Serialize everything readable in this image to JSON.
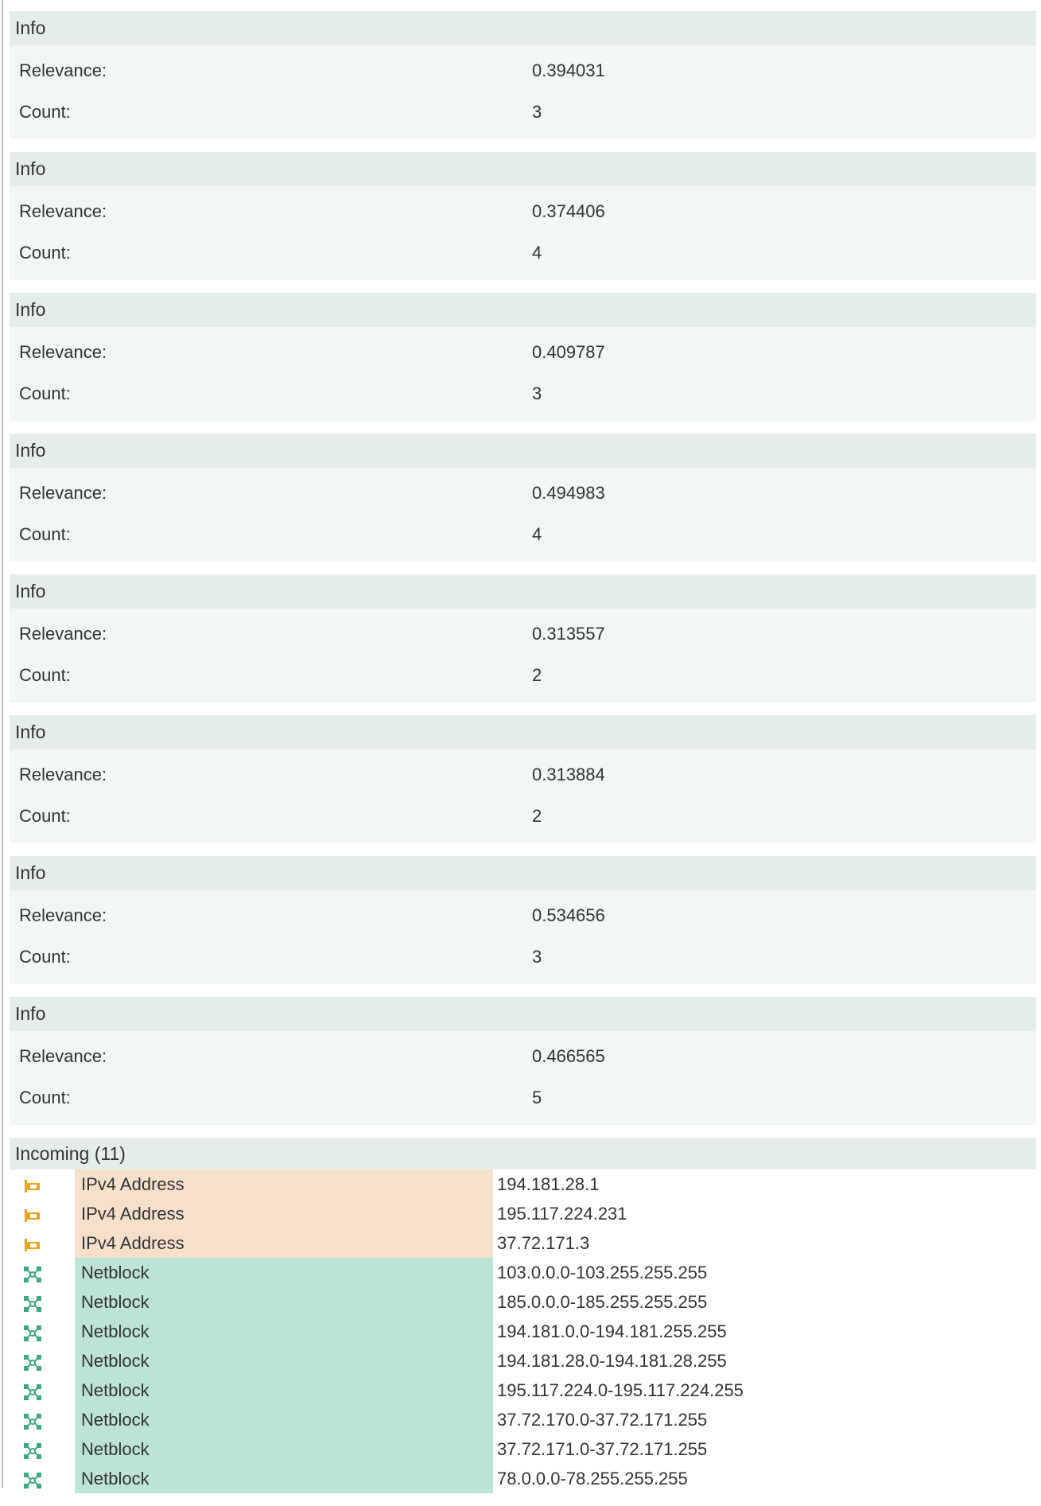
{
  "info_sections": [
    {
      "header": "Info",
      "relevance_label": "Relevance:",
      "relevance": "0.394031",
      "count_label": "Count:",
      "count": "3"
    },
    {
      "header": "Info",
      "relevance_label": "Relevance:",
      "relevance": "0.374406",
      "count_label": "Count:",
      "count": "4"
    },
    {
      "header": "Info",
      "relevance_label": "Relevance:",
      "relevance": "0.409787",
      "count_label": "Count:",
      "count": "3"
    },
    {
      "header": "Info",
      "relevance_label": "Relevance:",
      "relevance": "0.494983",
      "count_label": "Count:",
      "count": "4"
    },
    {
      "header": "Info",
      "relevance_label": "Relevance:",
      "relevance": "0.313557",
      "count_label": "Count:",
      "count": "2"
    },
    {
      "header": "Info",
      "relevance_label": "Relevance:",
      "relevance": "0.313884",
      "count_label": "Count:",
      "count": "2"
    },
    {
      "header": "Info",
      "relevance_label": "Relevance:",
      "relevance": "0.534656",
      "count_label": "Count:",
      "count": "3"
    },
    {
      "header": "Info",
      "relevance_label": "Relevance:",
      "relevance": "0.466565",
      "count_label": "Count:",
      "count": "5"
    }
  ],
  "incoming": {
    "header": "Incoming (11)",
    "rows": [
      {
        "icon": "ipv4-address-icon",
        "type": "IPv4 Address",
        "value": "194.181.28.1"
      },
      {
        "icon": "ipv4-address-icon",
        "type": "IPv4 Address",
        "value": "195.117.224.231"
      },
      {
        "icon": "ipv4-address-icon",
        "type": "IPv4 Address",
        "value": "37.72.171.3"
      },
      {
        "icon": "netblock-icon",
        "type": "Netblock",
        "value": "103.0.0.0-103.255.255.255"
      },
      {
        "icon": "netblock-icon",
        "type": "Netblock",
        "value": "185.0.0.0-185.255.255.255"
      },
      {
        "icon": "netblock-icon",
        "type": "Netblock",
        "value": "194.181.0.0-194.181.255.255"
      },
      {
        "icon": "netblock-icon",
        "type": "Netblock",
        "value": "194.181.28.0-194.181.28.255"
      },
      {
        "icon": "netblock-icon",
        "type": "Netblock",
        "value": "195.117.224.0-195.117.224.255"
      },
      {
        "icon": "netblock-icon",
        "type": "Netblock",
        "value": "37.72.170.0-37.72.171.255"
      },
      {
        "icon": "netblock-icon",
        "type": "Netblock",
        "value": "37.72.171.0-37.72.171.255"
      },
      {
        "icon": "netblock-icon",
        "type": "Netblock",
        "value": "78.0.0.0-78.255.255.255"
      }
    ]
  },
  "colors": {
    "header_bg": "#e4ecec",
    "body_bg": "#f2f6f6",
    "ipv4_bg": "#f7e0cb",
    "netblock_bg": "#bde3d6",
    "ipv4_icon": "#e8a317",
    "netblock_icon": "#3aa77e"
  }
}
